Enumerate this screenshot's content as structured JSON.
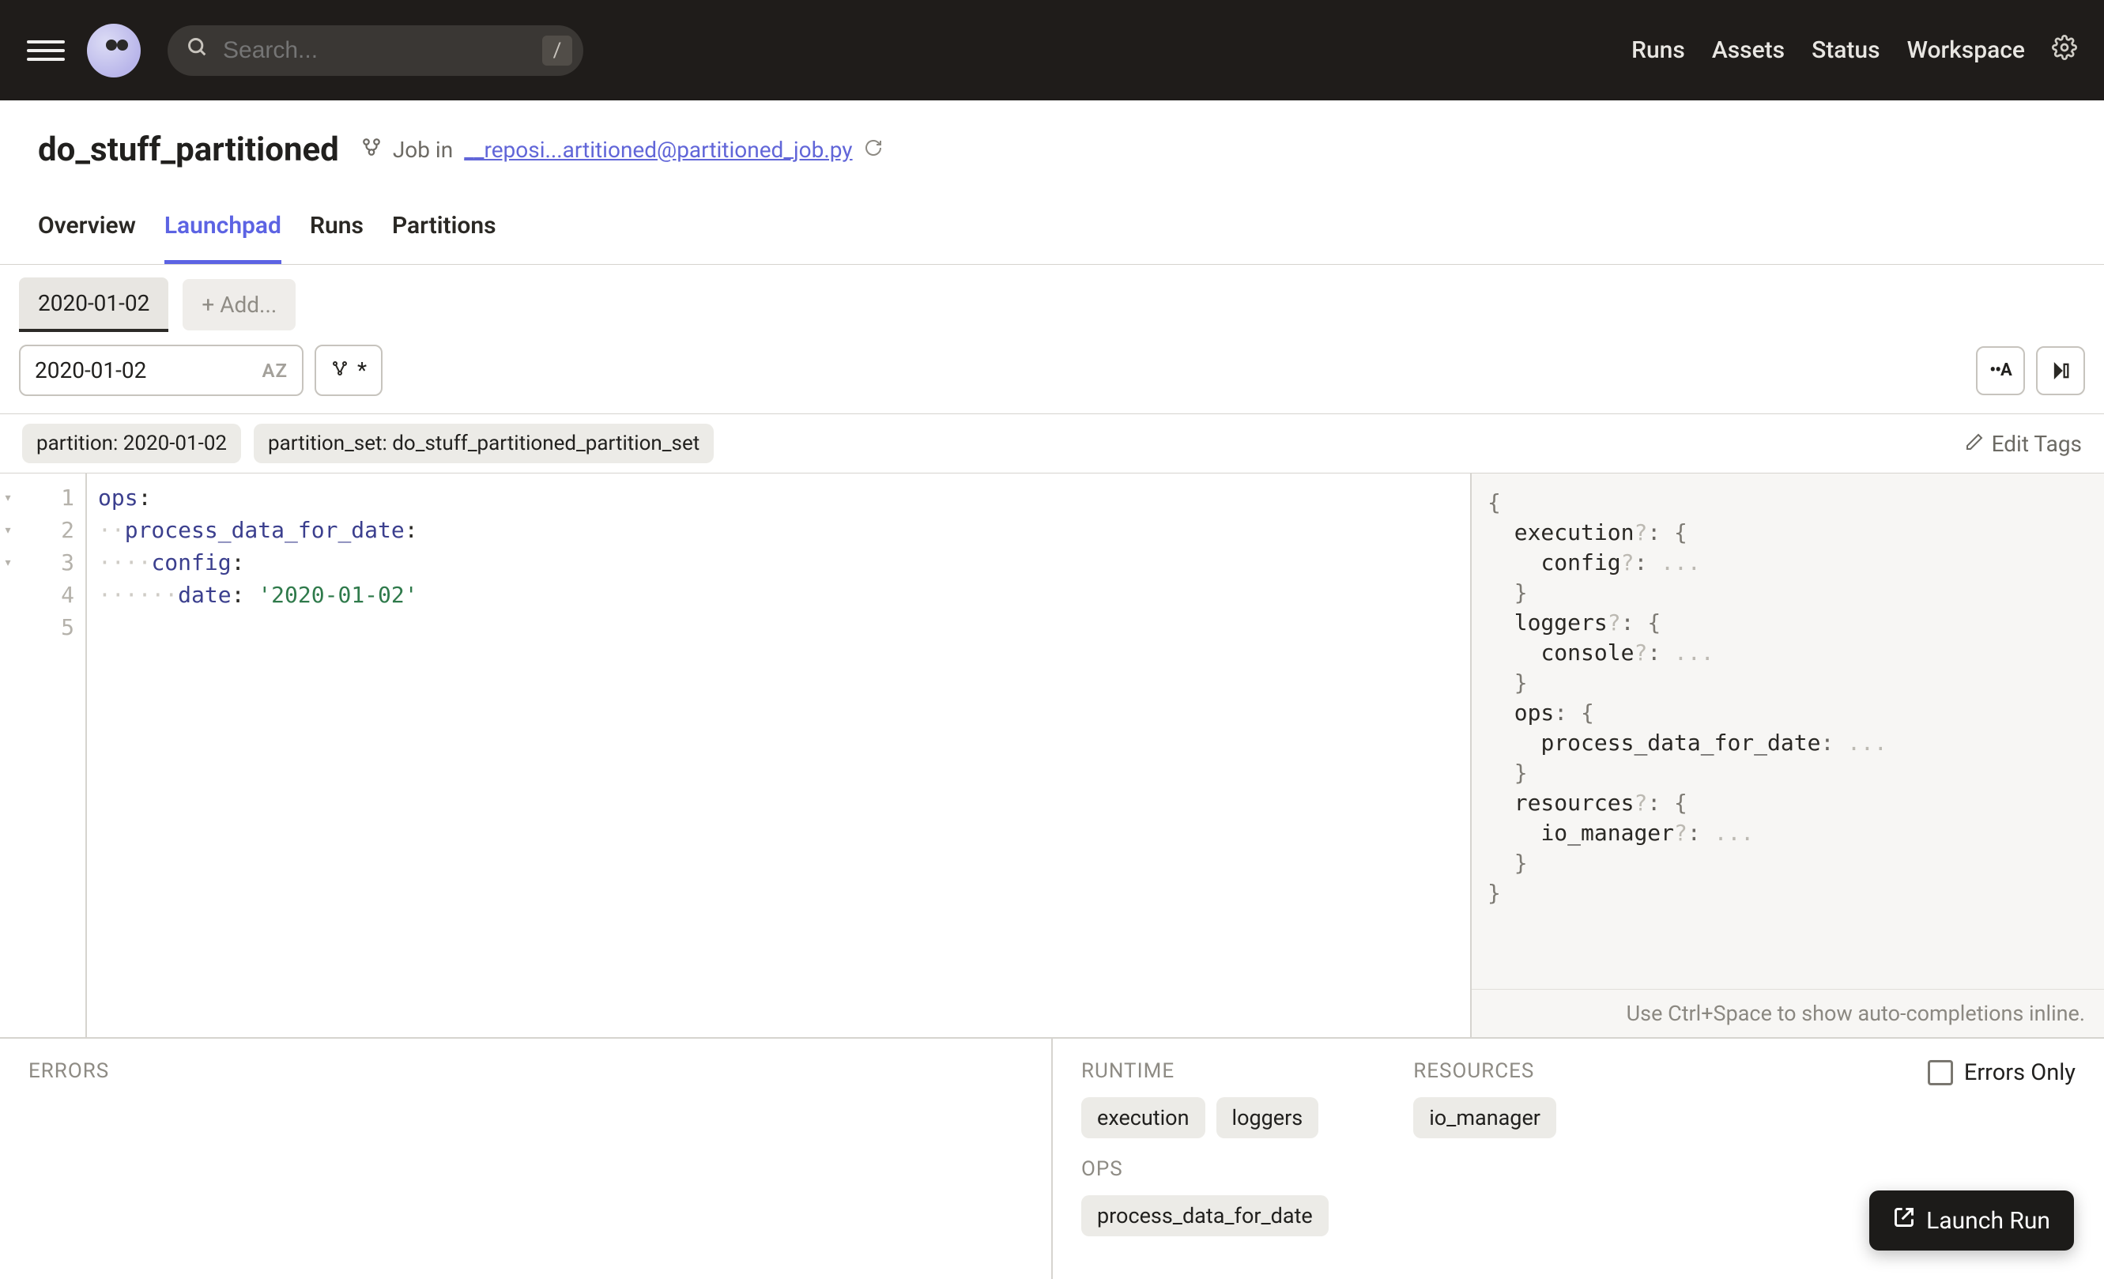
{
  "topnav": {
    "search_placeholder": "Search...",
    "search_key": "/",
    "links": [
      "Runs",
      "Assets",
      "Status",
      "Workspace"
    ]
  },
  "header": {
    "title": "do_stuff_partitioned",
    "job_in_prefix": "Job in ",
    "job_in_link": "__reposi...artitioned@partitioned_job.py",
    "tabs": [
      "Overview",
      "Launchpad",
      "Runs",
      "Partitions"
    ],
    "active_tab_index": 1
  },
  "partition_tabs": {
    "items": [
      "2020-01-02"
    ],
    "add_label": "+ Add..."
  },
  "filter": {
    "partition_selector_value": "2020-01-02",
    "az_label": "AZ",
    "filter_text": "*",
    "toolA": "••A",
    "toolB": "▶▯"
  },
  "tags": {
    "items": [
      "partition: 2020-01-02",
      "partition_set: do_stuff_partitioned_partition_set"
    ],
    "edit_label": "Edit Tags"
  },
  "editor": {
    "fold_marks": [
      "▾",
      "▾",
      "▾",
      "",
      ""
    ],
    "line_numbers": [
      "1",
      "2",
      "3",
      "4",
      "5"
    ],
    "lines_html": [
      "<span class='tok-key'>ops</span><span class='tok-punct'>:</span>",
      "<span class='dot'>··</span><span class='tok-key'>process_data_for_date</span><span class='tok-punct'>:</span>",
      "<span class='dot'>····</span><span class='tok-key'>config</span><span class='tok-punct'>:</span>",
      "<span class='dot'>······</span><span class='tok-key'>date</span><span class='tok-punct'>:</span> <span class='tok-str'>'2020-01-02'</span>",
      ""
    ]
  },
  "schema": {
    "lines_html": [
      "<span class='sc-brace'>{</span>",
      "  <span class='sc-key'>execution</span><span class='sc-opt'>?</span><span class='sc-colon'>:</span> <span class='sc-brace'>{</span>",
      "    <span class='sc-key'>config</span><span class='sc-opt'>?</span><span class='sc-colon'>:</span> <span class='sc-ell'>...</span>",
      "  <span class='sc-brace'>}</span>",
      "  <span class='sc-key'>loggers</span><span class='sc-opt'>?</span><span class='sc-colon'>:</span> <span class='sc-brace'>{</span>",
      "    <span class='sc-key'>console</span><span class='sc-opt'>?</span><span class='sc-colon'>:</span> <span class='sc-ell'>...</span>",
      "  <span class='sc-brace'>}</span>",
      "  <span class='sc-key'>ops</span><span class='sc-colon'>:</span> <span class='sc-brace'>{</span>",
      "    <span class='sc-key'>process_data_for_date</span><span class='sc-colon'>:</span> <span class='sc-ell'>...</span>",
      "  <span class='sc-brace'>}</span>",
      "  <span class='sc-key'>resources</span><span class='sc-opt'>?</span><span class='sc-colon'>:</span> <span class='sc-brace'>{</span>",
      "    <span class='sc-key'>io_manager</span><span class='sc-opt'>?</span><span class='sc-colon'>:</span> <span class='sc-ell'>...</span>",
      "  <span class='sc-brace'>}</span>",
      "<span class='sc-brace'>}</span>"
    ],
    "hint": "Use Ctrl+Space to show auto-completions inline."
  },
  "bottom": {
    "errors_label": "ERRORS",
    "runtime_label": "RUNTIME",
    "runtime_chips": [
      "execution",
      "loggers"
    ],
    "resources_label": "RESOURCES",
    "resources_chips": [
      "io_manager"
    ],
    "ops_label": "OPS",
    "ops_chips": [
      "process_data_for_date"
    ],
    "errors_only_label": "Errors Only"
  },
  "launch_label": "Launch Run"
}
